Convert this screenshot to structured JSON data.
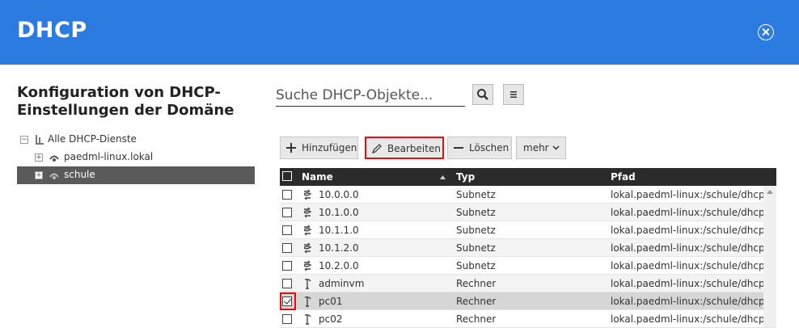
{
  "header": {
    "title": "DHCP"
  },
  "left": {
    "title": "Konfiguration von DHCP-Einstellungen der Domäne",
    "tree": [
      {
        "label": "Alle DHCP-Dienste",
        "expander": "−"
      },
      {
        "label": "paedml-linux.lokal",
        "expander": "+"
      },
      {
        "label": "schule",
        "expander": "+"
      }
    ]
  },
  "search": {
    "placeholder": "Suche DHCP-Objekte..."
  },
  "toolbar": {
    "add_label": "Hinzufügen",
    "edit_label": "Bearbeiten",
    "delete_label": "Löschen",
    "more_label": "mehr"
  },
  "table": {
    "columns": {
      "name": "Name",
      "type": "Typ",
      "path": "Pfad"
    },
    "rows": [
      {
        "name": "10.0.0.0",
        "type": "Subnetz",
        "path": "lokal.paedml-linux:/schule/dhcp...",
        "icon": "subnet-icon",
        "checked": false
      },
      {
        "name": "10.1.0.0",
        "type": "Subnetz",
        "path": "lokal.paedml-linux:/schule/dhcp...",
        "icon": "subnet-icon",
        "checked": false
      },
      {
        "name": "10.1.1.0",
        "type": "Subnetz",
        "path": "lokal.paedml-linux:/schule/dhcp...",
        "icon": "subnet-icon",
        "checked": false
      },
      {
        "name": "10.1.2.0",
        "type": "Subnetz",
        "path": "lokal.paedml-linux:/schule/dhcp...",
        "icon": "subnet-icon",
        "checked": false
      },
      {
        "name": "10.2.0.0",
        "type": "Subnetz",
        "path": "lokal.paedml-linux:/schule/dhcp...",
        "icon": "subnet-icon",
        "checked": false
      },
      {
        "name": "adminvm",
        "type": "Rechner",
        "path": "lokal.paedml-linux:/schule/dhcp...",
        "icon": "computer-icon",
        "checked": false
      },
      {
        "name": "pc01",
        "type": "Rechner",
        "path": "lokal.paedml-linux:/schule/dhcp...",
        "icon": "computer-icon",
        "checked": true
      },
      {
        "name": "pc02",
        "type": "Rechner",
        "path": "lokal.paedml-linux:/schule/dhcp...",
        "icon": "computer-icon",
        "checked": false
      }
    ]
  },
  "colors": {
    "header": "#2c7be0",
    "highlight": "#e01010",
    "table_header": "#2b2b2b",
    "tree_selected": "#5a5a5a"
  }
}
